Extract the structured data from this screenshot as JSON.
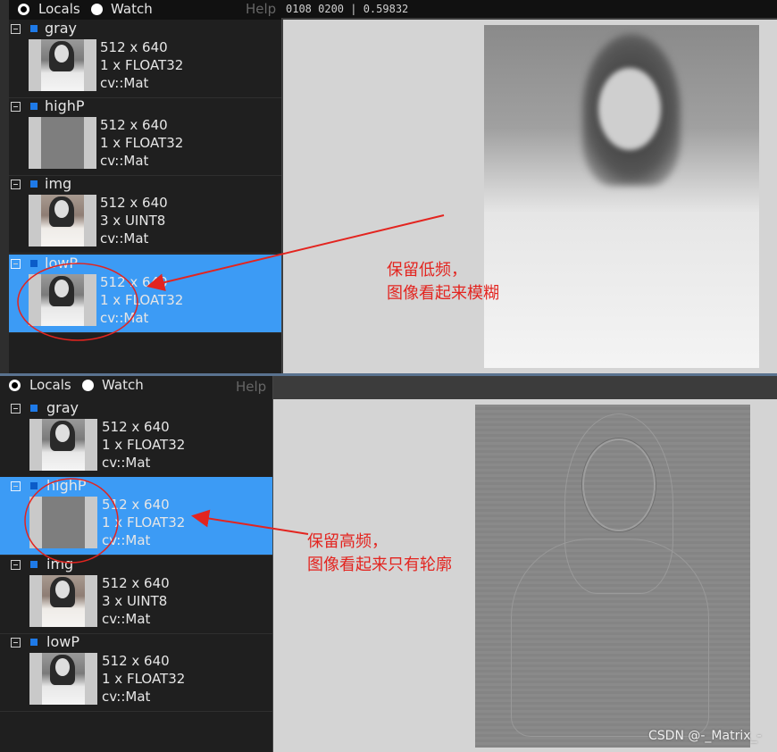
{
  "top_panel": {
    "tabs": {
      "locals": "Locals",
      "watch": "Watch",
      "help": "Help"
    },
    "pixel_readout": "0108 0200 | 0.59832",
    "variables": [
      {
        "name": "gray",
        "size": "512 x 640",
        "format": "1 x FLOAT32",
        "type": "cv::Mat"
      },
      {
        "name": "highP",
        "size": "512 x 640",
        "format": "1 x FLOAT32",
        "type": "cv::Mat"
      },
      {
        "name": "img",
        "size": "512 x 640",
        "format": "3 x UINT8",
        "type": "cv::Mat"
      },
      {
        "name": "lowP",
        "size": "512 x 640",
        "format": "1 x FLOAT32",
        "type": "cv::Mat"
      }
    ],
    "selected": "lowP",
    "annotation": [
      "保留低频，",
      "图像看起来模糊"
    ]
  },
  "bottom_panel": {
    "tabs": {
      "locals": "Locals",
      "watch": "Watch",
      "help": "Help"
    },
    "variables": [
      {
        "name": "gray",
        "size": "512 x 640",
        "format": "1 x FLOAT32",
        "type": "cv::Mat"
      },
      {
        "name": "highP",
        "size": "512 x 640",
        "format": "1 x FLOAT32",
        "type": "cv::Mat"
      },
      {
        "name": "img",
        "size": "512 x 640",
        "format": "3 x UINT8",
        "type": "cv::Mat"
      },
      {
        "name": "lowP",
        "size": "512 x 640",
        "format": "1 x FLOAT32",
        "type": "cv::Mat"
      }
    ],
    "selected": "highP",
    "annotation": [
      "保留高频，",
      "图像看起来只有轮廓"
    ]
  },
  "colors": {
    "annotation_red": "#e3241f",
    "selection_blue": "#3c9bf5"
  },
  "watermark": "CSDN @-_Matrix_-"
}
